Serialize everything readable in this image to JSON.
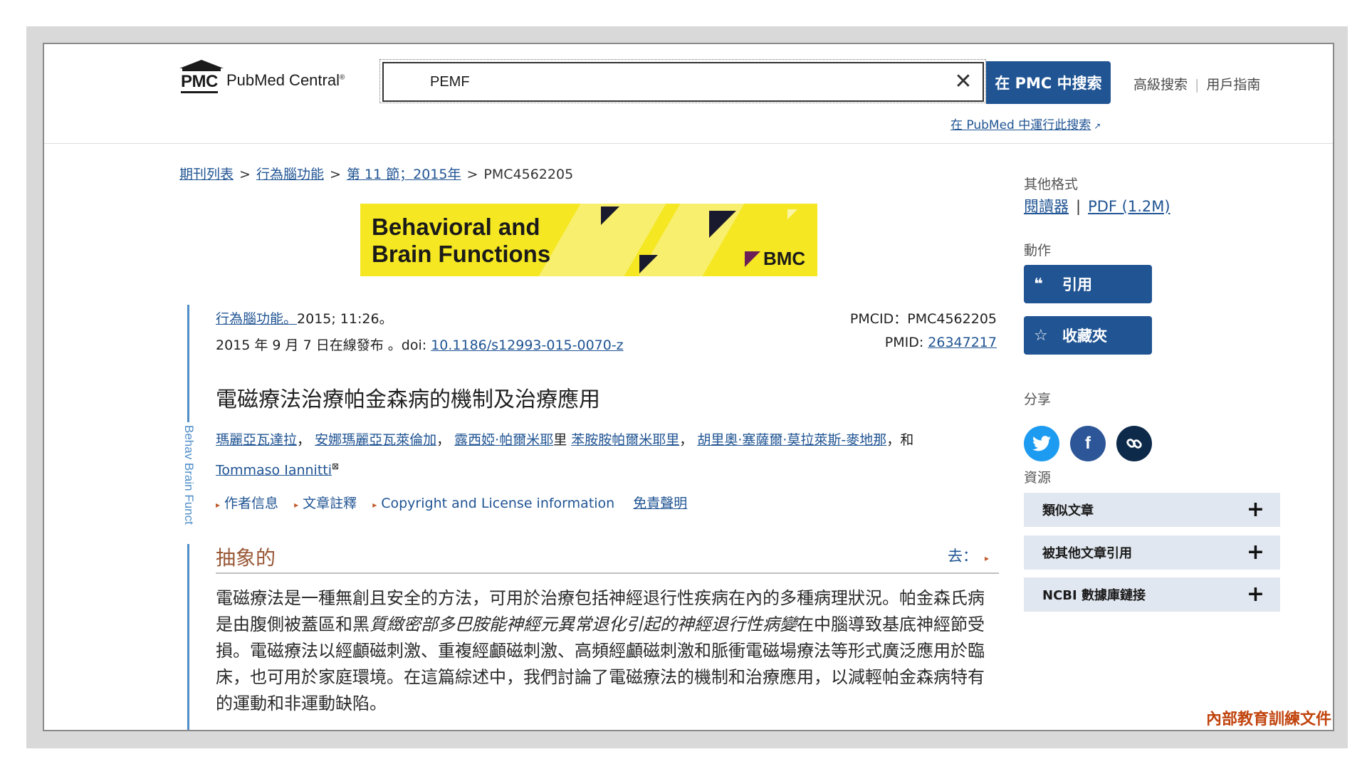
{
  "header": {
    "logo_pmc": "PMC",
    "logo_brand": "PubMed Central",
    "logo_reg": "®",
    "search_value": "PEMF",
    "search_button": "在 PMC 中搜索",
    "advanced_search": "高級搜索",
    "user_guide": "用戶指南",
    "pubmed_link": "在 PubMed 中運行此搜索"
  },
  "breadcrumb": {
    "items": [
      "期刊列表",
      "行為腦功能",
      "第 11 節；2015年"
    ],
    "current": "PMC4562205",
    "sep": ">"
  },
  "banner": {
    "line1": "Behavioral and",
    "line2": "Brain Functions",
    "publisher": "BMC"
  },
  "rail_label": "Behav Brain Funct",
  "article": {
    "journal_link": "行為腦功能。",
    "citation": "2015; 11:26。",
    "published": "2015 年 9 月 7 日在線發布 。doi: ",
    "doi": "10.1186/s12993-015-0070-z",
    "pmcid_label": "PMCID：PMC4562205",
    "pmid_label": "PMID: ",
    "pmid": "26347217",
    "title": "電磁療法治療帕金森病的機制及治療應用",
    "authors": [
      {
        "name": "瑪麗亞瓦達拉",
        "after": "，"
      },
      {
        "name": "安娜瑪麗亞瓦萊倫加",
        "after": "，"
      },
      {
        "name": "露西婭·帕爾米耶",
        "after": "里 "
      },
      {
        "name": "苯胺胺帕爾米耶里",
        "after": "，"
      },
      {
        "name": "胡里奧·塞薩爾·莫拉萊斯-麥地那",
        "after": "，和"
      },
      {
        "name": "Tommaso Iannitti",
        "after": ""
      }
    ],
    "author_sup": "⊠",
    "meta_links": [
      "作者信息",
      "文章註釋",
      "Copyright and License information"
    ],
    "disclaimer": "免責聲明"
  },
  "abstract": {
    "title": "抽象的",
    "goto": "去：",
    "text_part1": "電磁療法是一種無創且安全的方法，可用於治療包括神經退行性疾病在內的多種病理狀況。帕金森氏病是由腹側被蓋區和黑",
    "text_italic": "質緻密部多巴胺能神經元異常退化引起的神經退行性病變",
    "text_part2": "在中腦導致基底神經節受損。電磁療法以經顱磁刺激、重複經顱磁刺激、高頻經顱磁刺激和脈衝電磁場療法等形式廣泛應用於臨床，也可用於家庭環境。在這篇綜述中，我們討論了電磁療法的機制和治療應用，以減輕帕金森病特有的運動和非運動缺陷。"
  },
  "sidebar": {
    "formats_heading": "其他格式",
    "reader": "閱讀器",
    "pdf": "PDF (1.2M)",
    "actions_heading": "動作",
    "cite_button": "引用",
    "favorites_button": "收藏夾",
    "share_heading": "分享",
    "resources_heading": "資源",
    "resources": [
      "類似文章",
      "被其他文章引用",
      "NCBI 數據庫鏈接"
    ]
  },
  "colors": {
    "primary": "#205493",
    "twitter": "#1d9bf0",
    "facebook": "#2c5697",
    "link_share": "#0d2a4a",
    "banner_yellow": "#f5e721",
    "abstract_heading": "#985735"
  },
  "watermark": "內部教育訓練文件"
}
